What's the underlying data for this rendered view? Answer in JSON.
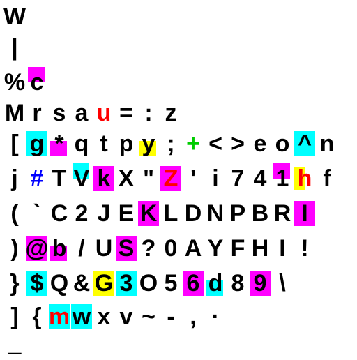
{
  "colors": {
    "text": "#000000",
    "background": "#ffffff",
    "magenta": "#ff00ff",
    "cyan": "#00ffff",
    "yellow": "#ffff00",
    "red": "#ff0000",
    "green": "#00cc00",
    "blue": "#0000ff"
  },
  "rows": [
    {
      "chars": [
        {
          "t": "W"
        }
      ]
    },
    {
      "chars": [
        {
          "t": "|"
        }
      ]
    },
    {
      "chars": [
        {
          "t": "%"
        },
        {
          "t": "c",
          "bg": "magenta",
          "bgShape": "top"
        }
      ]
    },
    {
      "chars": [
        {
          "t": "M"
        },
        {
          "t": "r"
        },
        {
          "t": "s"
        },
        {
          "t": "a"
        },
        {
          "t": "u",
          "fg": "red"
        },
        {
          "t": "="
        },
        {
          "t": ":"
        },
        {
          "t": "z"
        }
      ]
    },
    {
      "chars": [
        {
          "t": "["
        },
        {
          "t": "g",
          "bg": "cyan"
        },
        {
          "t": "*",
          "bg": "magenta",
          "bgShape": "bottom"
        },
        {
          "t": "q"
        },
        {
          "t": "t"
        },
        {
          "t": "p"
        },
        {
          "t": "y",
          "bg": "yellow",
          "bgShape": "bottom"
        },
        {
          "t": ";"
        },
        {
          "t": "+",
          "fg": "green"
        },
        {
          "t": "<"
        },
        {
          "t": ">"
        },
        {
          "t": "e"
        },
        {
          "t": "o"
        },
        {
          "t": "^",
          "bg": "cyan"
        },
        {
          "t": "n"
        }
      ]
    },
    {
      "chars": [
        {
          "t": "j"
        },
        {
          "t": "#",
          "fg": "blue"
        },
        {
          "t": "T"
        },
        {
          "t": "V",
          "bg": "cyan",
          "bgShape": "top"
        },
        {
          "t": "k",
          "bg": "magenta"
        },
        {
          "t": "X"
        },
        {
          "t": "\""
        },
        {
          "t": "Z",
          "bg": "magenta",
          "fg": "red"
        },
        {
          "t": "'"
        },
        {
          "t": "i"
        },
        {
          "t": "7"
        },
        {
          "t": "4"
        },
        {
          "t": "1",
          "bg": "magenta",
          "bgShape": "top"
        },
        {
          "t": "h",
          "fg": "red",
          "bg": "yellow",
          "bgShape": "left"
        },
        {
          "t": "f"
        }
      ]
    },
    {
      "chars": [
        {
          "t": "("
        },
        {
          "t": "`"
        },
        {
          "t": "C"
        },
        {
          "t": "2"
        },
        {
          "t": "J"
        },
        {
          "t": "E"
        },
        {
          "t": "K",
          "bg": "magenta"
        },
        {
          "t": "L"
        },
        {
          "t": "D"
        },
        {
          "t": "N"
        },
        {
          "t": "P"
        },
        {
          "t": "B"
        },
        {
          "t": "R"
        },
        {
          "t": "I",
          "bg": "magenta"
        }
      ]
    },
    {
      "chars": [
        {
          "t": ")"
        },
        {
          "t": "@",
          "bg": "magenta"
        },
        {
          "t": "b",
          "bg": "magenta",
          "bgShape": "bottom"
        },
        {
          "t": "/"
        },
        {
          "t": "U"
        },
        {
          "t": "S",
          "bg": "magenta"
        },
        {
          "t": "?"
        },
        {
          "t": "0"
        },
        {
          "t": "A"
        },
        {
          "t": "Y"
        },
        {
          "t": "F"
        },
        {
          "t": "H"
        },
        {
          "t": "I"
        },
        {
          "t": "!"
        }
      ]
    },
    {
      "chars": [
        {
          "t": "}"
        },
        {
          "t": "$",
          "bg": "cyan"
        },
        {
          "t": "Q"
        },
        {
          "t": "&"
        },
        {
          "t": "G",
          "bg": "yellow"
        },
        {
          "t": "3",
          "bg": "cyan"
        },
        {
          "t": "O"
        },
        {
          "t": "5"
        },
        {
          "t": "6",
          "bg": "magenta"
        },
        {
          "t": "d",
          "bg": "cyan",
          "bgShape": "bottom"
        },
        {
          "t": "8"
        },
        {
          "t": "9",
          "bg": "magenta"
        },
        {
          "t": "\\"
        }
      ]
    },
    {
      "chars": [
        {
          "t": "]"
        },
        {
          "t": "{"
        },
        {
          "t": "m",
          "bg": "cyan",
          "fg": "red"
        },
        {
          "t": "w",
          "bg": "cyan"
        },
        {
          "t": "x"
        },
        {
          "t": "v"
        },
        {
          "t": "~"
        },
        {
          "t": "-"
        },
        {
          "t": ","
        },
        {
          "t": "·"
        }
      ]
    },
    {
      "chars": [
        {
          "t": "_"
        }
      ]
    }
  ]
}
